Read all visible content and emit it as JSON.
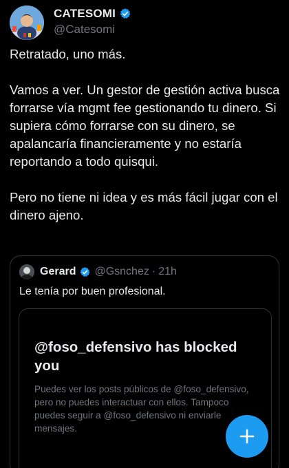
{
  "author": {
    "display_name": "CATESOMI",
    "handle": "@Catesomi"
  },
  "tweet": {
    "paragraphs": [
      "Retratado, uno más.",
      "Vamos a ver. Un gestor de gestión activa busca forrarse vía mgmt fee gestionando tu dinero. Si supiera cómo forrarse con su dinero, se apalancaría financieramente y no estaría reportando a todo quisqui.",
      "Pero no tiene ni idea y es más fácil jugar con el dinero ajeno."
    ]
  },
  "quote": {
    "name": "Gerard",
    "handle": "@Gsnchez",
    "separator": "·",
    "time": "21h",
    "text": "Le tenía por buen profesional.",
    "blocked_title": "@foso_defensivo has blocked you",
    "blocked_description": "Puedes ver los posts públicos de @foso_defensivo, pero no puedes interactuar con ellos. Tampoco puedes seguir a @foso_defensivo ni enviarle mensajes."
  },
  "icons": {
    "verified": "verified-badge-icon",
    "compose": "plus-icon"
  },
  "colors": {
    "background": "#000000",
    "text": "#e7e9ea",
    "muted": "#71767b",
    "border": "#2f3336",
    "accent": "#1d9bf0"
  }
}
